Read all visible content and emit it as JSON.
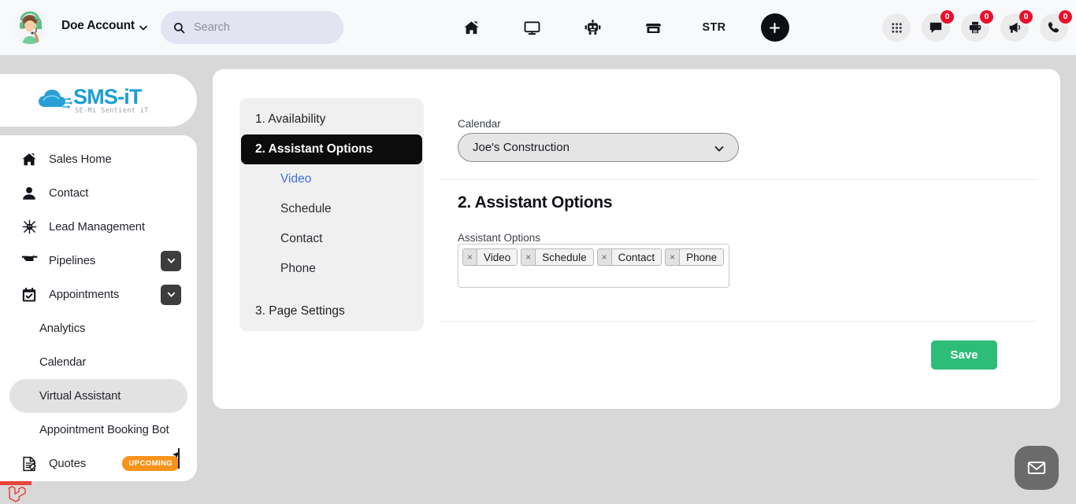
{
  "topbar": {
    "account_name": "Doe Account",
    "account_caret_icon": "chevron-down-icon",
    "avatar_icon": "user-avatar",
    "search": {
      "placeholder": "Search",
      "value": "",
      "icon": "search-icon"
    },
    "nav_items": [
      {
        "name": "home",
        "icon": "home-icon",
        "label": ""
      },
      {
        "name": "desktop",
        "icon": "monitor-icon",
        "label": ""
      },
      {
        "name": "bot",
        "icon": "robot-icon",
        "label": ""
      },
      {
        "name": "store",
        "icon": "store-icon",
        "label": ""
      },
      {
        "name": "str",
        "icon": "",
        "label": "STR"
      }
    ],
    "add_button": {
      "label": "+",
      "icon": "plus-icon",
      "color": "#0d0f14"
    },
    "right_icons": [
      {
        "name": "apps-grid",
        "icon": "grid-icon",
        "badge": ""
      },
      {
        "name": "messages",
        "icon": "chat-bubble-icon",
        "badge": "0"
      },
      {
        "name": "print",
        "icon": "printer-icon",
        "badge": "0"
      },
      {
        "name": "announcements",
        "icon": "megaphone-icon",
        "badge": "0"
      },
      {
        "name": "calls",
        "icon": "phone-icon",
        "badge": "0"
      }
    ],
    "badge_color": "#e8112d"
  },
  "brand": {
    "logo_text": "SMS-iT",
    "logo_tagline": "SE-Mi Sentient iT",
    "logo_color": "#1a9ed4"
  },
  "sidebar": {
    "items": [
      {
        "label": "Sales Home",
        "icon": "home-icon",
        "indent": false,
        "chevron": false,
        "badge": "",
        "active": false
      },
      {
        "label": "Contact",
        "icon": "person-icon",
        "indent": false,
        "chevron": false,
        "badge": "",
        "active": false
      },
      {
        "label": "Lead Management",
        "icon": "lead-network-icon",
        "indent": false,
        "chevron": false,
        "badge": "",
        "active": false
      },
      {
        "label": "Pipelines",
        "icon": "pipeline-icon",
        "indent": false,
        "chevron": true,
        "badge": "",
        "active": false
      },
      {
        "label": "Appointments",
        "icon": "calendar-check-icon",
        "indent": false,
        "chevron": true,
        "badge": "",
        "active": false
      },
      {
        "label": "Analytics",
        "icon": "",
        "indent": true,
        "chevron": false,
        "badge": "",
        "active": false
      },
      {
        "label": "Calendar",
        "icon": "",
        "indent": true,
        "chevron": false,
        "badge": "",
        "active": false
      },
      {
        "label": "Virtual Assistant",
        "icon": "",
        "indent": true,
        "chevron": false,
        "badge": "",
        "active": true
      },
      {
        "label": "Appointment Booking Bot",
        "icon": "",
        "indent": true,
        "chevron": false,
        "badge": "",
        "active": false
      },
      {
        "label": "Quotes",
        "icon": "quote-doc-icon",
        "indent": false,
        "chevron": false,
        "badge": "UPCOMING",
        "active": false
      }
    ],
    "badge_color": "#f7931a"
  },
  "steps": {
    "items": [
      {
        "label": "1. Availability",
        "type": "step",
        "active": false
      },
      {
        "label": "2. Assistant Options",
        "type": "step",
        "active": true
      },
      {
        "label": "Video",
        "type": "substep",
        "selected": true
      },
      {
        "label": "Schedule",
        "type": "substep",
        "selected": false
      },
      {
        "label": "Contact",
        "type": "substep",
        "selected": false
      },
      {
        "label": "Phone",
        "type": "substep",
        "selected": false
      },
      {
        "label": "3. Page Settings",
        "type": "step",
        "active": false
      }
    ],
    "active_color": "#0c0c0c",
    "selected_substep_color": "#3c6df0"
  },
  "form": {
    "calendar_label": "Calendar",
    "calendar_value": "Joe's Construction",
    "calendar_caret_icon": "chevron-down-icon",
    "section_title": "2. Assistant Options",
    "options_label": "Assistant Options",
    "tags": [
      {
        "label": "Video",
        "remove": "×"
      },
      {
        "label": "Schedule",
        "remove": "×"
      },
      {
        "label": "Contact",
        "remove": "×"
      },
      {
        "label": "Phone",
        "remove": "×"
      }
    ],
    "save_label": "Save",
    "save_color": "#2ebd79"
  },
  "floating": {
    "chat_icon": "envelope-icon",
    "chat_color": "#6b6b6b",
    "debugbar_icon": "laravel-logo-icon"
  }
}
